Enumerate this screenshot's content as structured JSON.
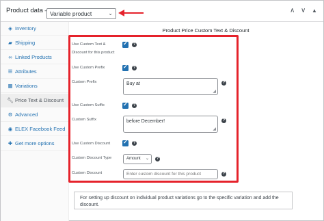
{
  "header": {
    "title": "Product data —",
    "product_type": "Variable product",
    "collapse_icons": [
      "chevron-up-icon",
      "chevron-down-icon",
      "triangle-up-icon"
    ]
  },
  "sidebar": {
    "items": [
      {
        "label": "Inventory",
        "icon": "diamond-icon"
      },
      {
        "label": "Shipping",
        "icon": "truck-icon"
      },
      {
        "label": "Linked Products",
        "icon": "link-icon"
      },
      {
        "label": "Attributes",
        "icon": "list-icon"
      },
      {
        "label": "Variations",
        "icon": "grid-icon"
      },
      {
        "label": "Price Text & Discount",
        "icon": "wrench-icon"
      },
      {
        "label": "Advanced",
        "icon": "gear-icon"
      },
      {
        "label": "ELEX Facebook Feed",
        "icon": "rss-icon"
      },
      {
        "label": "Get more options",
        "icon": "plugin-icon"
      }
    ],
    "active_index": 5
  },
  "section": {
    "title": "Product Price Custom Text & Discount"
  },
  "fields": {
    "use_custom_text_label_1": "Use Custom Text &",
    "use_custom_text_label_2": "Discount for this product",
    "use_custom_prefix_label": "Use Custom Prefix",
    "custom_prefix_label": "Custom Prefix",
    "custom_prefix_value": "Buy at",
    "use_custom_suffix_label": "Use Custom Suffix",
    "custom_suffix_label": "Custom Suffix",
    "custom_suffix_value": "before December!",
    "use_custom_discount_label": "Use Custom Discount",
    "custom_discount_type_label": "Custom Discount Type",
    "custom_discount_type_value": "Amount",
    "custom_discount_label": "Custom Discount",
    "custom_discount_placeholder": "Enter custom discount for this product"
  },
  "notice": {
    "text": "For setting up discount on individual product variations go to the specific variation and add the discount."
  },
  "colors": {
    "accent": "#2271b1",
    "highlight_red": "#e5222b"
  }
}
